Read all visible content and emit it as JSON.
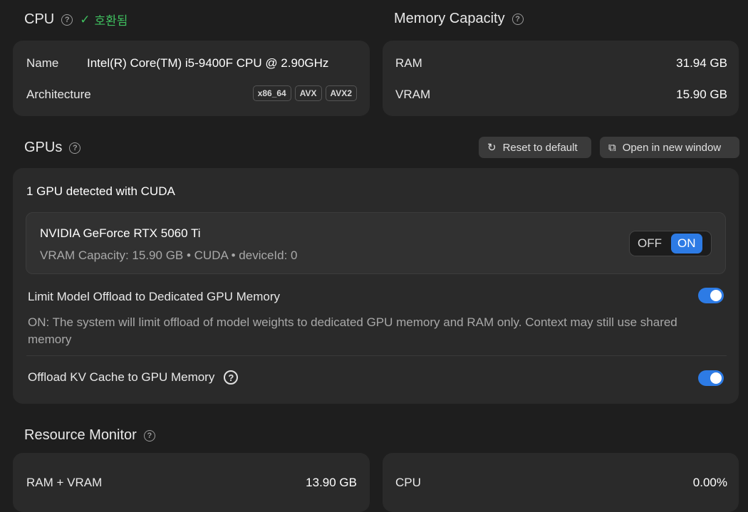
{
  "cpu": {
    "title": "CPU",
    "compat_check": "✓",
    "compat_label": "호환됨",
    "name_label": "Name",
    "name_value": "Intel(R) Core(TM) i5-9400F CPU @ 2.90GHz",
    "arch_label": "Architecture",
    "arch_tags": [
      "x86_64",
      "AVX",
      "AVX2"
    ]
  },
  "memory": {
    "title": "Memory Capacity",
    "ram_label": "RAM",
    "ram_value": "31.94 GB",
    "vram_label": "VRAM",
    "vram_value": "15.90 GB"
  },
  "gpus": {
    "title": "GPUs",
    "reset_button": "Reset to default",
    "open_window_button": "Open in new window",
    "detected": "1 GPU detected with CUDA",
    "gpu_name": "NVIDIA GeForce RTX 5060 Ti",
    "gpu_details": "VRAM Capacity: 15.90 GB • CUDA • deviceId: 0",
    "toggle_off": "OFF",
    "toggle_on": "ON",
    "limit_offload_label": "Limit Model Offload to Dedicated GPU Memory",
    "limit_offload_desc": "ON: The system will limit offload of model weights to dedicated GPU memory and RAM only. Context may still use shared memory",
    "kv_cache_label": "Offload KV Cache to GPU Memory"
  },
  "resource": {
    "title": "Resource Monitor",
    "ram_vram_label": "RAM + VRAM",
    "ram_vram_value": "13.90 GB",
    "cpu_label": "CPU",
    "cpu_value": "0.00%"
  },
  "colors": {
    "accent": "#2d7be5",
    "success": "#3fbf5f",
    "bg": "#1e1e1e",
    "card": "#2a2a2a"
  },
  "icons": {
    "help": "?",
    "reset": "↻",
    "open_window": "⧉"
  }
}
